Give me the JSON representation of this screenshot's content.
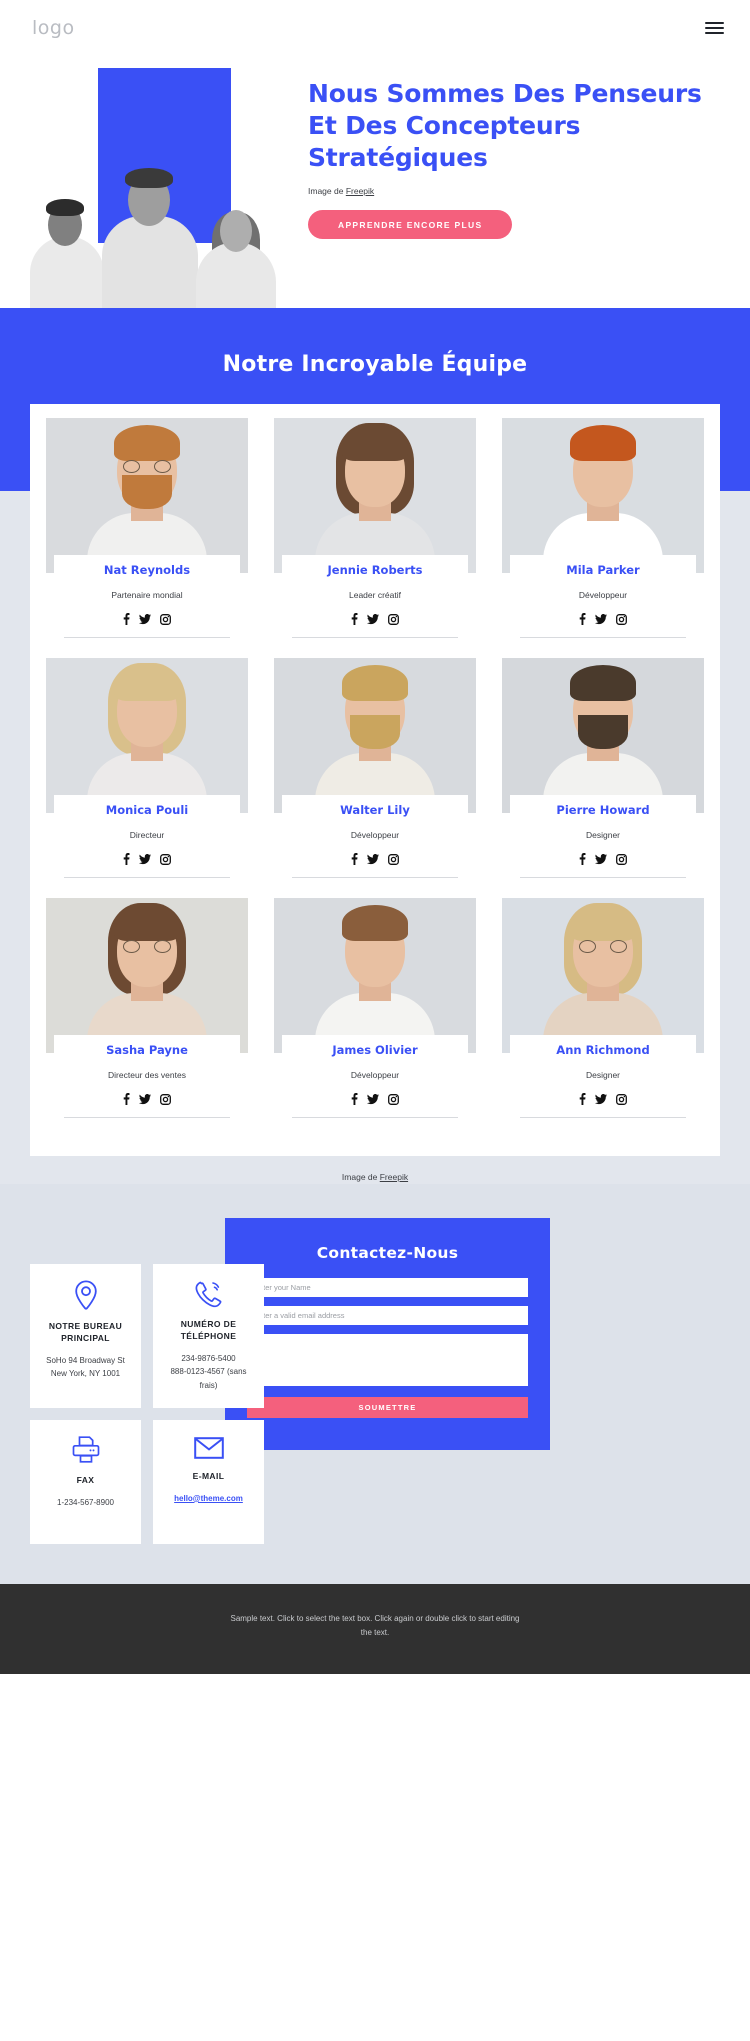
{
  "header": {
    "logo": "logo",
    "menu_icon": "hamburger-icon"
  },
  "hero": {
    "title": "Nous Sommes Des Penseurs Et Des Concepteurs Stratégiques",
    "attribution_prefix": "Image de ",
    "attribution_link": "Freepik",
    "cta_label": "APPRENDRE ENCORE PLUS",
    "accent_blue": "#3a50f5",
    "accent_pink": "#f4607d"
  },
  "team": {
    "title": "Notre Incroyable Équipe",
    "attribution_prefix": "Image de ",
    "attribution_link": "Freepik",
    "social": [
      "facebook-icon",
      "twitter-icon",
      "instagram-icon"
    ],
    "members": [
      {
        "name": "Nat Reynolds",
        "role": "Partenaire mondial"
      },
      {
        "name": "Jennie Roberts",
        "role": "Leader créatif"
      },
      {
        "name": "Mila Parker",
        "role": "Développeur"
      },
      {
        "name": "Monica Pouli",
        "role": "Directeur"
      },
      {
        "name": "Walter Lily",
        "role": "Développeur"
      },
      {
        "name": "Pierre Howard",
        "role": "Designer"
      },
      {
        "name": "Sasha Payne",
        "role": "Directeur des ventes"
      },
      {
        "name": "James Olivier",
        "role": "Développeur"
      },
      {
        "name": "Ann Richmond",
        "role": "Designer"
      }
    ]
  },
  "contact": {
    "cards": [
      {
        "icon": "location-pin-icon",
        "title": "NOTRE BUREAU PRINCIPAL",
        "line1": "SoHo 94 Broadway St",
        "line2": "New York, NY 1001"
      },
      {
        "icon": "phone-icon",
        "title": "NUMÉRO DE TÉLÉPHONE",
        "line1": "234-9876-5400",
        "line2": "888-0123-4567 (sans frais)"
      },
      {
        "icon": "printer-icon",
        "title": "FAX",
        "line1": "1-234-567-8900",
        "line2": ""
      },
      {
        "icon": "envelope-icon",
        "title": "E-MAIL",
        "line1": "hello@theme.com",
        "line2": ""
      }
    ],
    "form": {
      "title": "Contactez-Nous",
      "name_placeholder": "Enter your Name",
      "email_placeholder": "Enter a valid email address",
      "message_placeholder": "",
      "submit_label": "SOUMETTRE"
    }
  },
  "footer": {
    "text": "Sample text. Click to select the text box. Click again or double click to start editing the text."
  }
}
